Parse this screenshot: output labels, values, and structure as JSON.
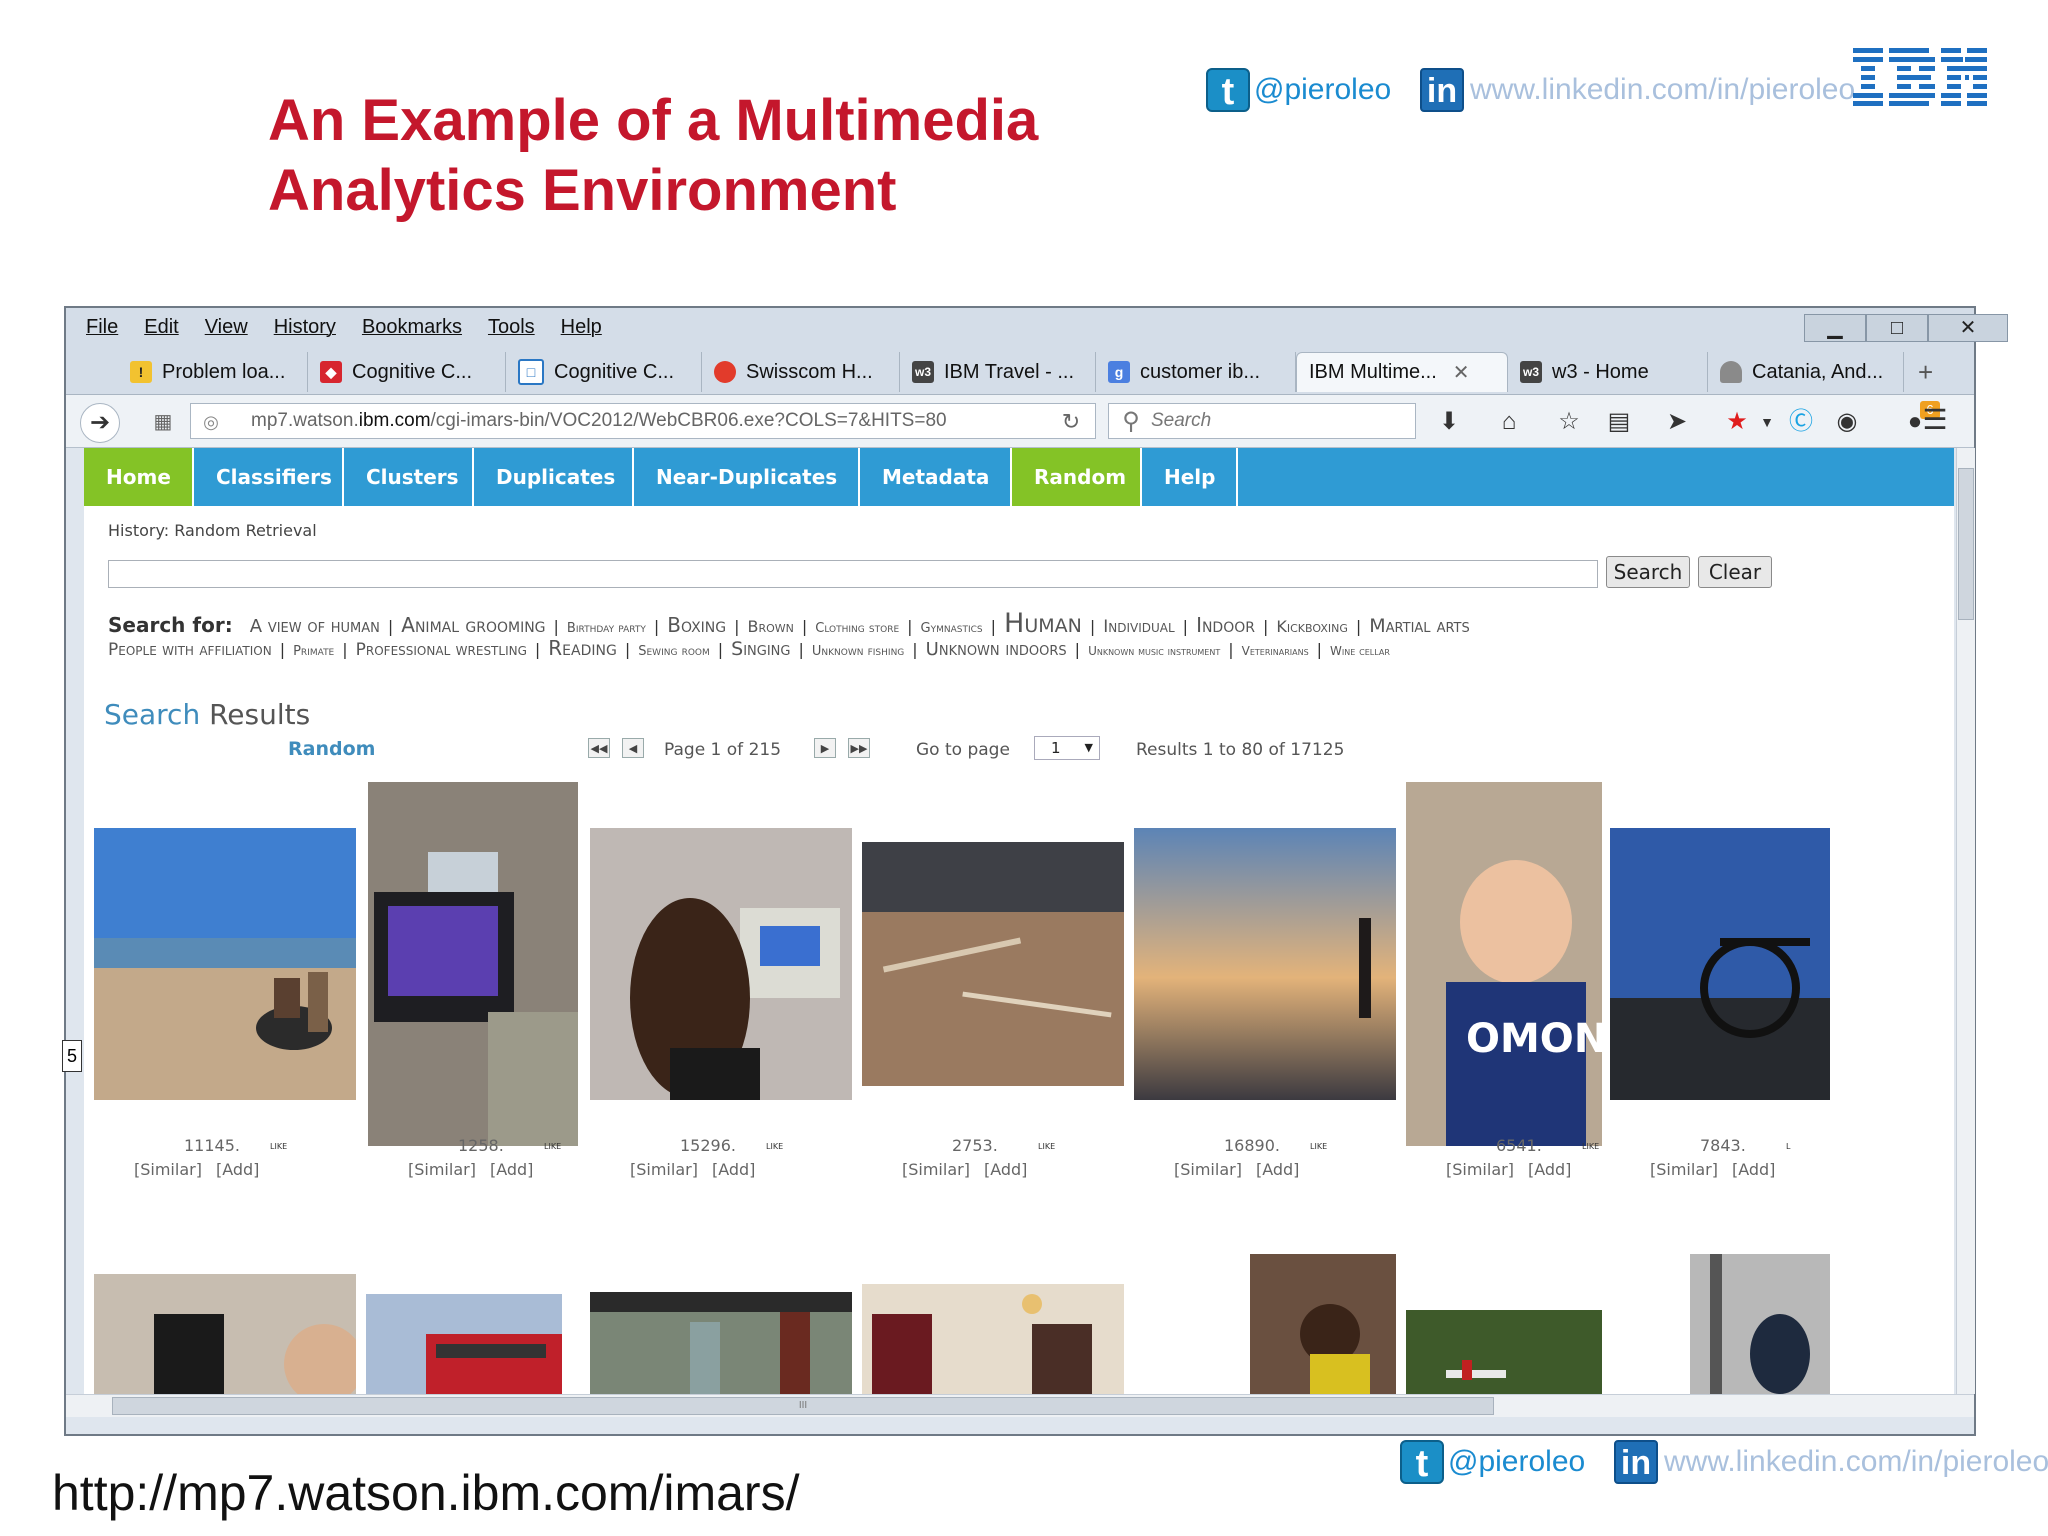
{
  "slide": {
    "title_line1": "An Example of a Multimedia",
    "title_line2": "Analytics Environment",
    "twitter": "@pieroleo",
    "linkedin": "www.linkedin.com/in/pieroleo",
    "bottom_url": "http://mp7.watson.ibm.com/imars/",
    "side_badge": "5",
    "brand_color": "#c4172c"
  },
  "browser": {
    "menu": [
      "File",
      "Edit",
      "View",
      "History",
      "Bookmarks",
      "Tools",
      "Help"
    ],
    "tabs": [
      {
        "label": "Problem loa...",
        "icon": "warning-icon"
      },
      {
        "label": "Cognitive C...",
        "icon": "page-icon"
      },
      {
        "label": "Cognitive C...",
        "icon": "window-icon"
      },
      {
        "label": "Swisscom H...",
        "icon": "swisscom-icon"
      },
      {
        "label": "IBM Travel - ...",
        "icon": "w3-icon"
      },
      {
        "label": "customer ib...",
        "icon": "google-icon"
      },
      {
        "label": "IBM Multime...",
        "icon": "",
        "active": true
      },
      {
        "label": "w3 - Home",
        "icon": "w3-icon"
      },
      {
        "label": "Catania, And...",
        "icon": "person-icon"
      }
    ],
    "new_tab": "+",
    "url_prefix": "mp7.watson.",
    "url_domain": "ibm.com",
    "url_rest": "/cgi-imars-bin/VOC2012/WebCBR06.exe?COLS=7&HITS=80",
    "search_placeholder": "Search",
    "extension_badge": "6",
    "scrollbar_grip": "III"
  },
  "site": {
    "nav": [
      {
        "label": "Home",
        "active": true
      },
      {
        "label": "Classifiers",
        "active": false
      },
      {
        "label": "Clusters",
        "active": false
      },
      {
        "label": "Duplicates",
        "active": false
      },
      {
        "label": "Near-Duplicates",
        "active": false
      },
      {
        "label": "Metadata",
        "active": false
      },
      {
        "label": "Random",
        "active": true
      },
      {
        "label": "Help",
        "active": false
      }
    ],
    "history": "History: Random Retrieval",
    "search_value": "",
    "search_button": "Search",
    "clear_button": "Clear",
    "search_for_label": "Search for:",
    "tags_line1": [
      {
        "text": "A view of human",
        "size": 18
      },
      {
        "text": "Animal grooming",
        "size": 20
      },
      {
        "text": "Birthday party",
        "size": 13
      },
      {
        "text": "Boxing",
        "size": 20
      },
      {
        "text": "Brown",
        "size": 16
      },
      {
        "text": "Clothing store",
        "size": 13
      },
      {
        "text": "Gymnastics",
        "size": 13
      },
      {
        "text": "Human",
        "size": 27
      },
      {
        "text": "Individual",
        "size": 17
      },
      {
        "text": "Indoor",
        "size": 20
      },
      {
        "text": "Kickboxing",
        "size": 16
      },
      {
        "text": "Martial arts",
        "size": 19
      }
    ],
    "tags_line2": [
      {
        "text": "People with affiliation",
        "size": 17
      },
      {
        "text": "Primate",
        "size": 13
      },
      {
        "text": "Professional wrestling",
        "size": 17
      },
      {
        "text": "Reading",
        "size": 20
      },
      {
        "text": "Sewing room",
        "size": 13
      },
      {
        "text": "Singing",
        "size": 19
      },
      {
        "text": "Unknown fishing",
        "size": 13
      },
      {
        "text": "Unknown indoors",
        "size": 18
      },
      {
        "text": "Unknown music instrument",
        "size": 12
      },
      {
        "text": "Veterinarians",
        "size": 12
      },
      {
        "text": "Wine cellar",
        "size": 12
      }
    ],
    "results_title_a": "Search",
    "results_title_b": "Results",
    "mode_label": "Random",
    "page_info": "Page 1 of 215",
    "goto_label": "Go to page",
    "goto_value": "1",
    "results_info": "Results 1 to 80 of 17125",
    "row1": [
      {
        "id": "11145.",
        "likes": "like",
        "similar": "[Similar]",
        "add": "[Add]",
        "scene": "beach-horse"
      },
      {
        "id": "1258.",
        "likes": "like",
        "similar": "[Similar]",
        "add": "[Add]",
        "scene": "tv-room"
      },
      {
        "id": "15296.",
        "likes": "like",
        "similar": "[Similar]",
        "add": "[Add]",
        "scene": "girl-computer"
      },
      {
        "id": "2753.",
        "likes": "like",
        "similar": "[Similar]",
        "add": "[Add]",
        "scene": "driftwood"
      },
      {
        "id": "16890.",
        "likes": "like",
        "similar": "[Similar]",
        "add": "[Add]",
        "scene": "sunset-beach"
      },
      {
        "id": "6541.",
        "likes": "like",
        "similar": "[Similar]",
        "add": "[Add]",
        "scene": "baby"
      },
      {
        "id": "7843.",
        "likes": "l",
        "similar": "[Similar]",
        "add": "[Add]",
        "scene": "bicycle"
      }
    ],
    "row2": [
      "speaker-room",
      "red-bus",
      "bottles",
      "dining-room",
      "basketball-crowd",
      "airplane-field",
      "street-people"
    ]
  }
}
